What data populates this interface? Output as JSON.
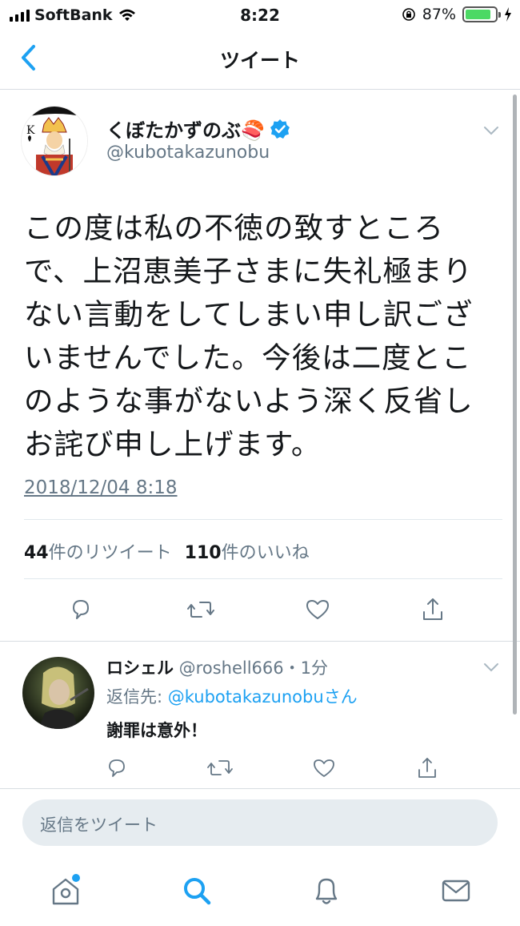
{
  "status": {
    "carrier": "SoftBank",
    "time": "8:22",
    "battery_text": "87%",
    "battery_level": 0.87
  },
  "nav": {
    "title": "ツイート",
    "back_icon": "chevron-left-icon"
  },
  "tweet": {
    "author_name": "くぼたかずのぶ🍣",
    "verified": true,
    "handle": "@kubotakazunobu",
    "text_lines": [
      "この度は私の不徳の致すところ",
      "で、上沼恵美子さまに失礼極まり",
      "ない言動をしてしまい申し訳ござ",
      "いませんでした。今後は二度とこ",
      "のような事がないよう深く反省し",
      "お詫び申し上げます。"
    ],
    "date": "2018/12/04 8:18",
    "retweet_count": "44",
    "retweet_label": "件のリツイート",
    "like_count": "110",
    "like_label": "件のいいね"
  },
  "reply": {
    "name": "ロシェル",
    "meta": " @roshell666・1分",
    "reply_to_label": "返信先: ",
    "reply_to_mention": "@kubotakazunobuさん",
    "text": "謝罪は意外！"
  },
  "compose": {
    "placeholder": "返信をツイート"
  },
  "tabs": [
    "home-icon",
    "search-icon",
    "notifications-icon",
    "messages-icon"
  ],
  "colors": {
    "accent": "#1da1f2",
    "text": "#14171a",
    "secondary": "#657786",
    "battery": "#4cd964"
  }
}
